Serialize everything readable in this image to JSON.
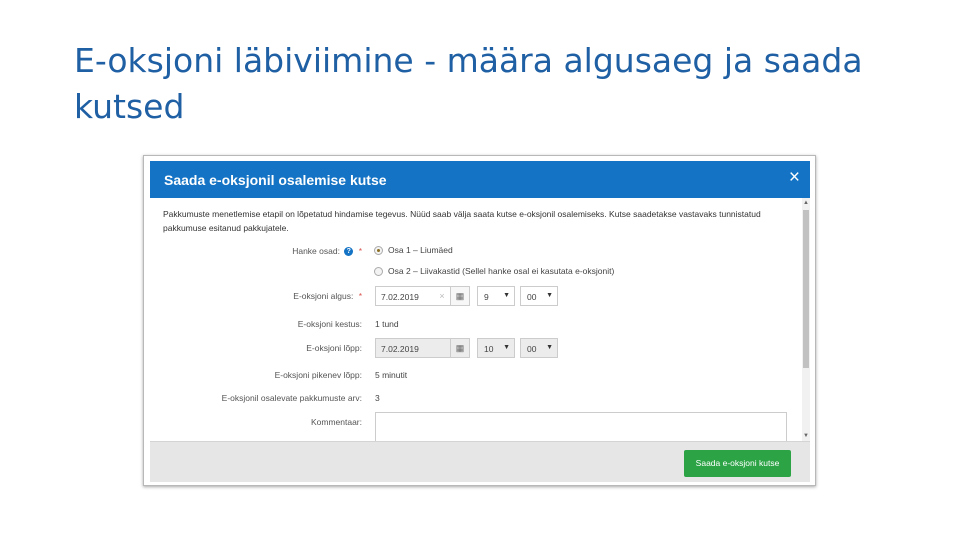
{
  "slide": {
    "title": "E-oksjoni läbiviimine - määra algusaeg ja saada kutsed"
  },
  "dialog": {
    "title": "Saada e-oksjonil osalemise kutse",
    "close_label": "×",
    "intro": "Pakkumuste menetlemise etapil on lõpetatud hindamise tegevus. Nüüd saab välja saata kutse e-oksjonil osalemiseks. Kutse saadetakse vastavaks tunnistatud pakkumuse esitanud pakkujatele.",
    "fields": {
      "hanke_osad": {
        "label": "Hanke osad:",
        "required_mark": "*",
        "help_icon": "?",
        "options": [
          {
            "label": "Osa 1 – Liumäed",
            "selected": true
          },
          {
            "label": "Osa 2 – Liivakastid (Sellel hanke osal ei kasutata e-oksjonit)",
            "selected": false
          }
        ]
      },
      "algus": {
        "label": "E-oksjoni algus:",
        "required_mark": "*",
        "date": "7.02.2019",
        "clear_icon": "×",
        "calendar_icon": "▦",
        "hour": "9",
        "minute": "00"
      },
      "kestus": {
        "label": "E-oksjoni kestus:",
        "value": "1 tund"
      },
      "lopp": {
        "label": "E-oksjoni lõpp:",
        "date": "7.02.2019",
        "calendar_icon": "▦",
        "hour": "10",
        "minute": "00"
      },
      "pikenev_lopp": {
        "label": "E-oksjoni pikenev lõpp:",
        "value": "5 minutit"
      },
      "pakkumuste_arv": {
        "label": "E-oksjonil osalevate pakkumuste arv:",
        "value": "3"
      },
      "kommentaar": {
        "label": "Kommentaar:",
        "value": ""
      }
    },
    "caret_icon": "▼",
    "scroll_up_icon": "▲",
    "scroll_down_icon": "▼",
    "submit_label": "Saada e-oksjoni kutse"
  },
  "colors": {
    "title_blue": "#1f5fa3",
    "header_blue": "#1473c4",
    "submit_green": "#2ca446"
  }
}
